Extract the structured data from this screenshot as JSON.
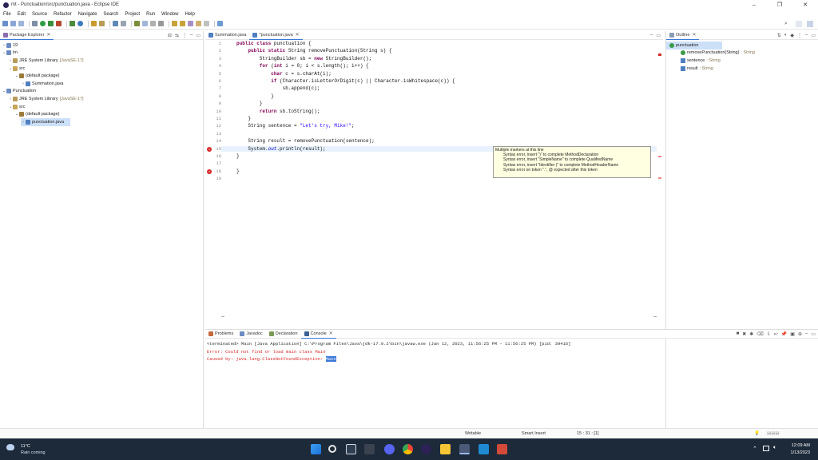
{
  "window": {
    "title": "mt - Punctuation/src/punctuation.java - Eclipse IDE",
    "buttons": [
      "–",
      "❐",
      "✕"
    ]
  },
  "menu": [
    "File",
    "Edit",
    "Source",
    "Refactor",
    "Navigate",
    "Search",
    "Project",
    "Run",
    "Window",
    "Help"
  ],
  "package_explorer": {
    "tab_label": "Package Explorer",
    "items": [
      {
        "label": "19",
        "depth": 0,
        "expand": "›",
        "icon": "project-icon"
      },
      {
        "label": "lm",
        "depth": 0,
        "expand": "⌄",
        "icon": "project-icon"
      },
      {
        "label": "JRE System Library",
        "suffix": "[JavaSE-17]",
        "depth": 1,
        "expand": "›",
        "icon": "library-icon"
      },
      {
        "label": "src",
        "depth": 1,
        "expand": "⌄",
        "icon": "folder-icon"
      },
      {
        "label": "(default package)",
        "depth": 2,
        "expand": "⌄",
        "icon": "package-icon"
      },
      {
        "label": "Summation.java",
        "depth": 3,
        "expand": "›",
        "icon": "java-file-icon"
      },
      {
        "label": "Punctuation",
        "depth": 0,
        "expand": "⌄",
        "icon": "project-icon"
      },
      {
        "label": "JRE System Library",
        "suffix": "[JavaSE-17]",
        "depth": 1,
        "expand": "›",
        "icon": "library-icon"
      },
      {
        "label": "src",
        "depth": 1,
        "expand": "⌄",
        "icon": "folder-icon"
      },
      {
        "label": "(default package)",
        "depth": 2,
        "expand": "⌄",
        "icon": "package-icon"
      },
      {
        "label": "punctuation.java",
        "depth": 3,
        "expand": "›",
        "icon": "java-file-icon",
        "selected": true
      }
    ]
  },
  "editor": {
    "tabs": [
      {
        "label": "Summation.java",
        "active": false
      },
      {
        "label": "*punctuation.java",
        "active": true
      }
    ],
    "line_numbers": [
      "1",
      "2",
      "3",
      "4",
      "5",
      "6",
      "7",
      "8",
      "9",
      "10",
      "11",
      "12",
      "13",
      "14",
      "15",
      "16",
      "17",
      "18",
      "19"
    ],
    "code_lines": [
      "public class punctuation {",
      "    public static String removePunctuation(String s) {",
      "        StringBuilder sb = new StringBuilder();",
      "        for (int i = 0; i < s.length(); i++) {",
      "            char c = s.charAt(i);",
      "            if (Character.isLetterOrDigit(c) || Character.isWhitespace(c)) {",
      "                sb.append(c);",
      "            }",
      "        }",
      "        return sb.toString();",
      "    }",
      "    String sentence = \"Let's try, Mike!\";",
      "",
      "    String result = removePunctuation(sentence);",
      "    System.out.println(result);",
      "}",
      "",
      "}",
      ""
    ],
    "error_lines": [
      15,
      18
    ],
    "tooltip": {
      "title": "Multiple markers at this line",
      "items": [
        "Syntax error, insert \")\" to complete MethodDeclaration",
        "Syntax error, insert \"SimpleName\" to complete QualifiedName",
        "Syntax error, insert \"Identifier (\" to complete MethodHeaderName",
        "Syntax error on token \".\", @ expected after this token"
      ]
    }
  },
  "outline": {
    "tab_label": "Outline",
    "items": [
      {
        "label": "punctuation",
        "depth": 0,
        "icon": "class-icon",
        "selected": true
      },
      {
        "label": "removePunctuation(String)",
        "type": ": String",
        "depth": 1,
        "icon": "method-icon"
      },
      {
        "label": "sentence",
        "type": ": String",
        "depth": 1,
        "icon": "field-icon"
      },
      {
        "label": "result",
        "type": ": String",
        "depth": 1,
        "icon": "field-icon"
      }
    ]
  },
  "bottom_panel": {
    "tabs": [
      "Problems",
      "Javadoc",
      "Declaration",
      "Console"
    ],
    "active_tab": "Console",
    "header": "<terminated> Main [Java Application] C:\\Program Files\\Java\\jdk-17.0.2\\bin\\javaw.exe (Jan 12, 2023, 11:56:25 PM – 11:56:25 PM) [pid: 39416]",
    "lines": [
      "Error: Could not find or load main class Main",
      "Caused by: java.lang.ClassNotFoundException: Main"
    ]
  },
  "status_bar": {
    "writable": "Writable",
    "insert_mode": "Smart Insert",
    "position": "15 : 31 : [1]"
  },
  "taskbar": {
    "weather_temp": "11°C",
    "weather_desc": "Rain coming",
    "time": "12:09 AM",
    "date": "1/13/2023"
  },
  "colors": {
    "error": "#d62b2b",
    "selection": "#cce0f7",
    "accent": "#3c78d8",
    "taskbar": "#1c2a3a",
    "keyword": "#7f0055",
    "string": "#2a00ff"
  }
}
